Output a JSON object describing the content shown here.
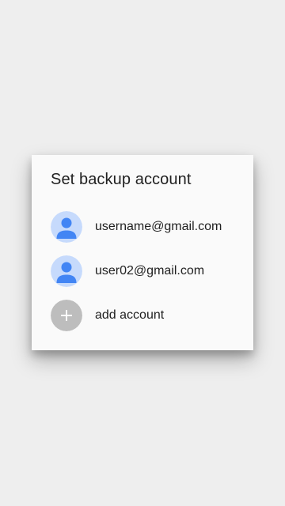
{
  "dialog": {
    "title": "Set backup account",
    "accounts": [
      {
        "email": "username@gmail.com",
        "icon": "account-avatar-icon"
      },
      {
        "email": "user02@gmail.com",
        "icon": "account-avatar-icon"
      }
    ],
    "add_account": {
      "label": "add account",
      "icon": "add-icon"
    }
  },
  "colors": {
    "background": "#eeeeee",
    "dialog_background": "#fafafa",
    "avatar_background": "#c6dafc",
    "avatar_figure": "#4285f4",
    "add_circle": "#bdbdbd",
    "text_primary": "#212121"
  }
}
